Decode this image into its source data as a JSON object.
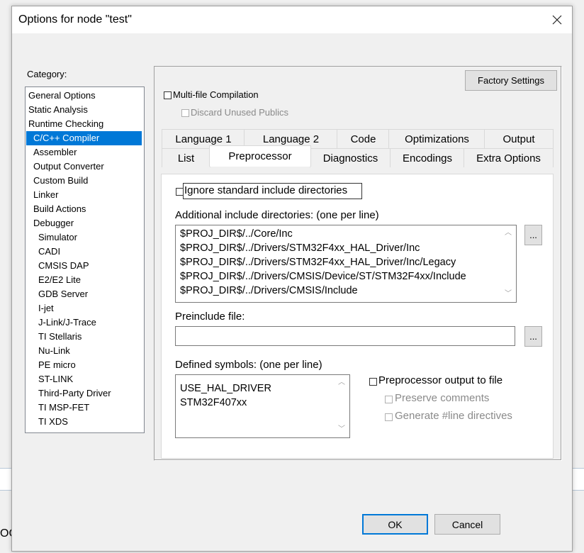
{
  "dialog": {
    "title": "Options for node \"test\"",
    "close_glyph": "✕"
  },
  "category": {
    "label": "Category:",
    "items": [
      {
        "label": "General Options",
        "indent": 0
      },
      {
        "label": "Static Analysis",
        "indent": 0
      },
      {
        "label": "Runtime Checking",
        "indent": 0
      },
      {
        "label": "C/C++ Compiler",
        "indent": 1,
        "selected": true
      },
      {
        "label": "Assembler",
        "indent": 1
      },
      {
        "label": "Output Converter",
        "indent": 1
      },
      {
        "label": "Custom Build",
        "indent": 1
      },
      {
        "label": "Linker",
        "indent": 1
      },
      {
        "label": "Build Actions",
        "indent": 1
      },
      {
        "label": "Debugger",
        "indent": 1
      },
      {
        "label": "Simulator",
        "indent": 2
      },
      {
        "label": "CADI",
        "indent": 2
      },
      {
        "label": "CMSIS DAP",
        "indent": 2
      },
      {
        "label": "E2/E2 Lite",
        "indent": 2
      },
      {
        "label": "GDB Server",
        "indent": 2
      },
      {
        "label": "I-jet",
        "indent": 2
      },
      {
        "label": "J-Link/J-Trace",
        "indent": 2
      },
      {
        "label": "TI Stellaris",
        "indent": 2
      },
      {
        "label": "Nu-Link",
        "indent": 2
      },
      {
        "label": "PE micro",
        "indent": 2
      },
      {
        "label": "ST-LINK",
        "indent": 2
      },
      {
        "label": "Third-Party Driver",
        "indent": 2
      },
      {
        "label": "TI MSP-FET",
        "indent": 2
      },
      {
        "label": "TI XDS",
        "indent": 2
      }
    ]
  },
  "panel": {
    "factory_settings": "Factory Settings",
    "multifile": "Multi-file Compilation",
    "discard_unused": "Discard Unused Publics"
  },
  "tabs": {
    "row1": [
      "Language 1",
      "Language 2",
      "Code",
      "Optimizations",
      "Output"
    ],
    "row2": [
      "List",
      "Preprocessor",
      "Diagnostics",
      "Encodings",
      "Extra Options"
    ],
    "active": "Preprocessor"
  },
  "preprocessor": {
    "ignore_std": "Ignore standard include directories",
    "additional_label": "Additional include directories: (one per line)",
    "include_dirs": [
      "$PROJ_DIR$/../Core/Inc",
      "$PROJ_DIR$/../Drivers/STM32F4xx_HAL_Driver/Inc",
      "$PROJ_DIR$/../Drivers/STM32F4xx_HAL_Driver/Inc/Legacy",
      "$PROJ_DIR$/../Drivers/CMSIS/Device/ST/STM32F4xx/Include",
      "$PROJ_DIR$/../Drivers/CMSIS/Include"
    ],
    "browse_label": "...",
    "preinclude_label": "Preinclude file:",
    "preinclude_value": "",
    "defined_label": "Defined symbols: (one per line)",
    "defined_symbols": [
      "USE_HAL_DRIVER",
      "STM32F407xx"
    ],
    "pp_output": "Preprocessor output to file",
    "preserve_comments": "Preserve comments",
    "generate_line": "Generate #line directives"
  },
  "footer": {
    "ok": "OK",
    "cancel": "Cancel"
  },
  "background": {
    "fragment": "OC"
  }
}
